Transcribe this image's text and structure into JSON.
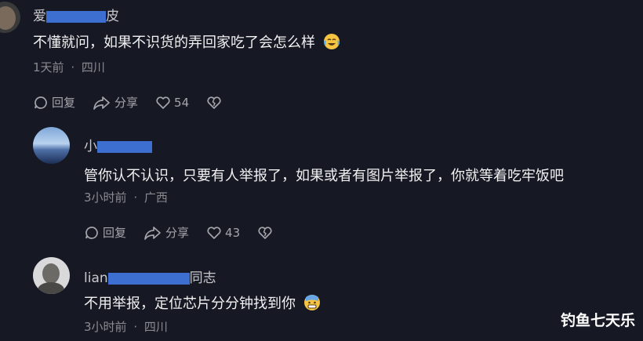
{
  "comments": [
    {
      "user_prefix": "爱",
      "user_suffix": "皮",
      "text": "不懂就问，如果不识货的弄回家吃了会怎么样",
      "time": "1天前",
      "separator": "·",
      "location": "四川",
      "reply_label": "回复",
      "share_label": "分享",
      "likes": "54"
    },
    {
      "user_prefix": "小",
      "user_suffix": "",
      "text": "管你认不认识，只要有人举报了，如果或者有图片举报了，你就等着吃牢饭吧",
      "time": "3小时前",
      "separator": "·",
      "location": "广西",
      "reply_label": "回复",
      "share_label": "分享",
      "likes": "43"
    },
    {
      "user_prefix": "lian",
      "user_suffix": "同志",
      "text": "不用举报，定位芯片分分钟找到你",
      "time": "3小时前",
      "separator": "·",
      "location": "四川"
    }
  ],
  "watermark": "钓鱼七天乐",
  "colors": {
    "background": "#161823",
    "redaction": "#3d6fd0"
  }
}
